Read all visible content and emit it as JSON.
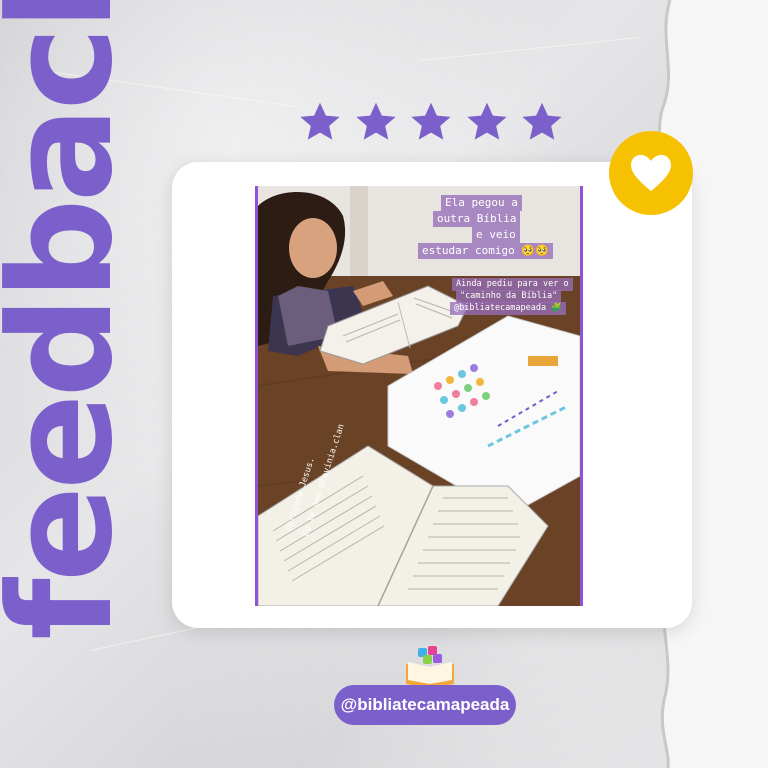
{
  "post": {
    "headline": "feedback",
    "rating_stars": 5,
    "accent_color": "#7b60cc",
    "badge_color": "#f6c100",
    "handle": "@bibliatecamapeada"
  },
  "photo": {
    "caption_lines": [
      "Ela pegou a",
      "outra Bíblia",
      "e veio",
      "estudar comigo 🥺🥺"
    ],
    "note_lines": [
      "Ainda pediu para ver o",
      "\"caminho da Bíblia\"",
      "@bibliatecamapeada 🧩"
    ],
    "thanks_lines": [
      "Obrigada Jesus.",
      "Eu te amo @lavinia.clan"
    ]
  },
  "icons": {
    "stars": "star-icon",
    "badge": "heart-icon",
    "logo": "book-puzzle-icon"
  }
}
